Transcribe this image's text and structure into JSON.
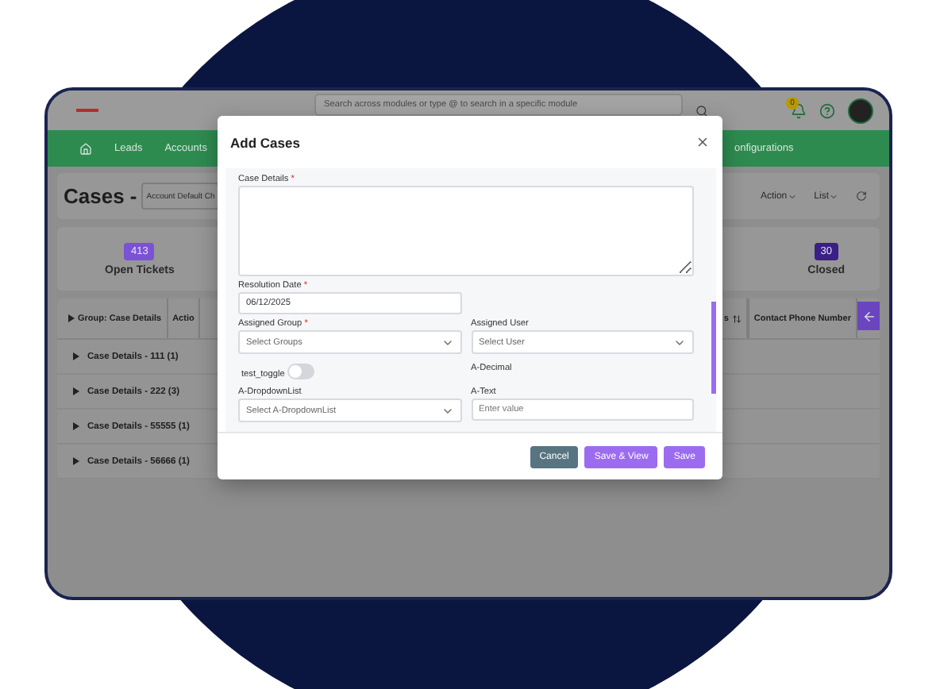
{
  "topbar": {
    "search_placeholder": "Search across modules or type @ to search in a specific module",
    "notification_count": "0"
  },
  "nav": {
    "items": [
      {
        "label": "Leads"
      },
      {
        "label": "Accounts"
      }
    ],
    "trailing_item": "onfigurations"
  },
  "header": {
    "title": "Cases -",
    "view": "Account Default Ch",
    "actions": [
      "Action",
      "List"
    ]
  },
  "stats": [
    {
      "count": "413",
      "label": "Open Tickets",
      "color": "#7b52d6"
    },
    {
      "count": "30",
      "label": "Closed",
      "color": "#3a1f86"
    }
  ],
  "table": {
    "columns": [
      {
        "label": "Group: Case Details",
        "sortable": false
      },
      {
        "label": "Actio",
        "sortable": false
      }
    ],
    "right_columns": [
      {
        "label": "s",
        "sortable": true
      },
      {
        "label": "Contact Phone Number",
        "sortable": false
      }
    ],
    "groups": [
      {
        "label": "Case Details - 111 (1)",
        "expanded": false
      },
      {
        "label": "Case Details - 222 (3)",
        "expanded": false
      },
      {
        "label": "Case Details - 55555 (1)",
        "expanded": false
      },
      {
        "label": "Case Details - 56666 (1)",
        "expanded": false
      }
    ]
  },
  "modal": {
    "title": "Add Cases",
    "required_mark": "*",
    "rows": [
      [
        {
          "kind": "textarea",
          "label": "Case Details",
          "required": true
        }
      ],
      [
        {
          "kind": "input",
          "label": "Resolution Date",
          "required": true,
          "value": "06/12/2025"
        }
      ],
      [
        {
          "kind": "select",
          "label": "Assigned Group",
          "required": true,
          "placeholder": "Select Groups"
        },
        {
          "kind": "select",
          "label": "Assigned User",
          "required": false,
          "placeholder": "Select User"
        }
      ],
      [
        {
          "kind": "toggle",
          "label": "test_toggle",
          "on": false
        },
        {
          "kind": "label",
          "label": "A-Decimal"
        }
      ],
      [
        {
          "kind": "select",
          "label": "A-DropdownList",
          "required": false,
          "placeholder": "Select A-DropdownList"
        },
        {
          "kind": "input",
          "label": "A-Text",
          "required": false,
          "placeholder": "Enter value"
        }
      ]
    ],
    "buttons": [
      {
        "label": "Cancel",
        "kind": "secondary"
      },
      {
        "label": "Save & View",
        "kind": "primary"
      },
      {
        "label": "Save",
        "kind": "primary"
      }
    ]
  }
}
